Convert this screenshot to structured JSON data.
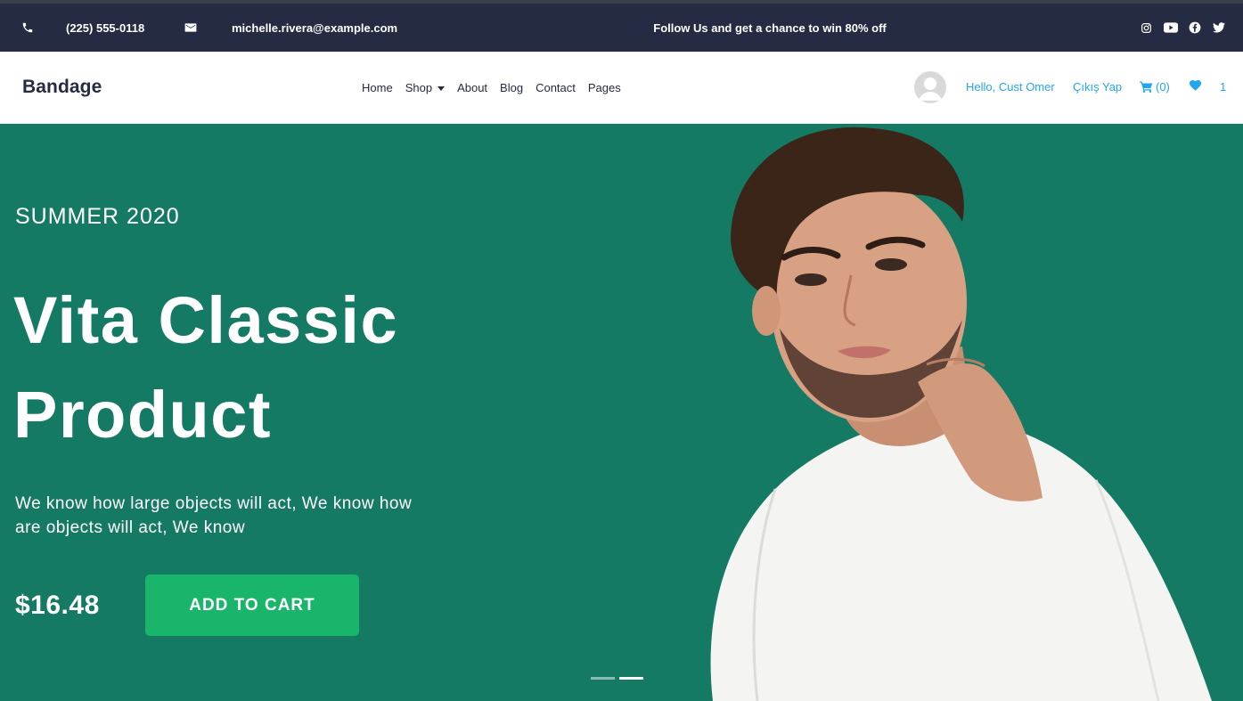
{
  "topbar": {
    "phone": "(225) 555-0118",
    "email": "michelle.rivera@example.com",
    "promo": "Follow Us and get a chance to win 80% off",
    "social_icons": [
      "instagram-icon",
      "youtube-icon",
      "facebook-icon",
      "twitter-icon"
    ]
  },
  "navbar": {
    "brand": "Bandage",
    "links": [
      "Home",
      "Shop",
      "About",
      "Blog",
      "Contact",
      "Pages"
    ],
    "greeting": "Hello, Cust Omer",
    "logout": "Çıkış Yap",
    "cart_count": "(0)",
    "favorites_count": "1"
  },
  "hero": {
    "season": "SUMMER 2020",
    "title_line1": "Vita Classic",
    "title_line2": "Product",
    "description": "We know how large objects will act, We know how are objects will act, We know",
    "price": "$16.48",
    "cta_label": "ADD TO CART",
    "slide_count": 2,
    "active_slide": 2
  },
  "colors": {
    "topbar_bg": "#252b42",
    "hero_bg": "#157a63",
    "cta_bg": "#19b56a",
    "link_accent": "#23a6f0"
  }
}
